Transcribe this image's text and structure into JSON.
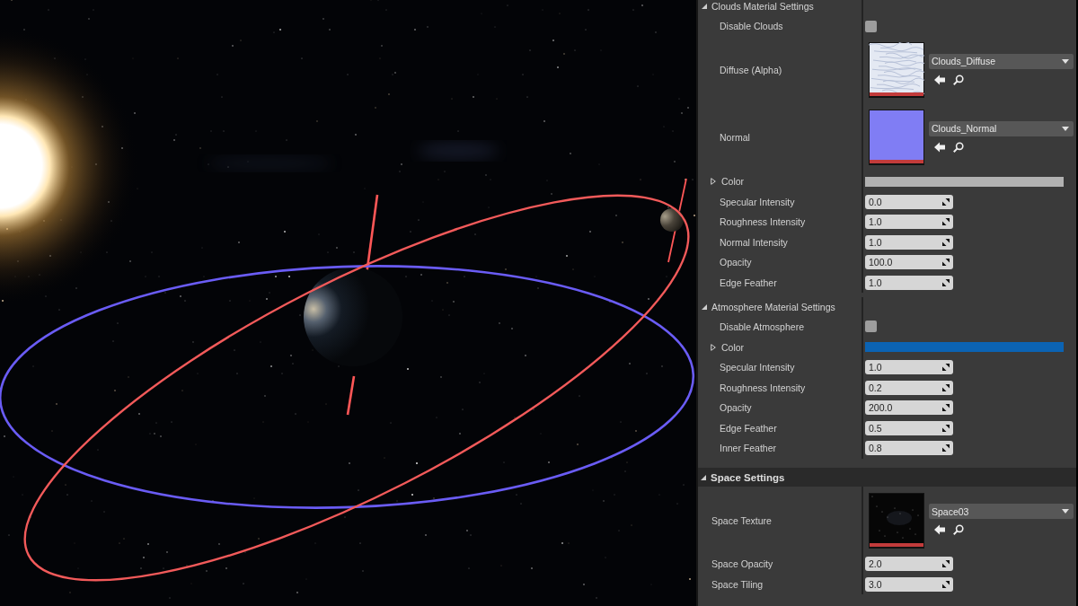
{
  "details_panel": {
    "sections": [
      {
        "kind": "group",
        "title": "Clouds Material Settings",
        "expanded": true,
        "rows": [
          {
            "kind": "checkbox",
            "label": "Disable Clouds",
            "checked": false
          },
          {
            "kind": "texture",
            "label": "Diffuse (Alpha)",
            "thumbnail": {
              "kind": "clouds"
            },
            "asset": "Clouds_Diffuse"
          },
          {
            "kind": "texture",
            "label": "Normal",
            "thumbnail": {
              "kind": "normal_map"
            },
            "asset": "Clouds_Normal"
          },
          {
            "kind": "color",
            "label": "Color",
            "expanded": false,
            "color": "#b1b1b1"
          },
          {
            "kind": "number",
            "label": "Specular Intensity",
            "value": "0.0"
          },
          {
            "kind": "number",
            "label": "Roughness Intensity",
            "value": "1.0"
          },
          {
            "kind": "number",
            "label": "Normal Intensity",
            "value": "1.0"
          },
          {
            "kind": "number",
            "label": "Opacity",
            "value": "100.0"
          },
          {
            "kind": "number",
            "label": "Edge Feather",
            "value": "1.0"
          }
        ]
      },
      {
        "kind": "group",
        "title": "Atmosphere Material Settings",
        "expanded": true,
        "rows": [
          {
            "kind": "checkbox",
            "label": "Disable Atmosphere",
            "checked": false
          },
          {
            "kind": "color",
            "label": "Color",
            "expanded": false,
            "color": "#0b63b3"
          },
          {
            "kind": "number",
            "label": "Specular Intensity",
            "value": "1.0"
          },
          {
            "kind": "number",
            "label": "Roughness Intensity",
            "value": "0.2"
          },
          {
            "kind": "number",
            "label": "Opacity",
            "value": "200.0"
          },
          {
            "kind": "number",
            "label": "Edge Feather",
            "value": "0.5"
          },
          {
            "kind": "number",
            "label": "Inner Feather",
            "value": "0.8"
          }
        ]
      },
      {
        "kind": "category",
        "title": "Space Settings",
        "expanded": true,
        "rows": [
          {
            "kind": "texture",
            "label": "Space Texture",
            "thumbnail": {
              "kind": "starfield"
            },
            "asset": "Space03"
          },
          {
            "kind": "number",
            "label": "Space Opacity",
            "value": "2.0"
          },
          {
            "kind": "number",
            "label": "Space Tiling",
            "value": "3.0"
          }
        ]
      }
    ]
  }
}
